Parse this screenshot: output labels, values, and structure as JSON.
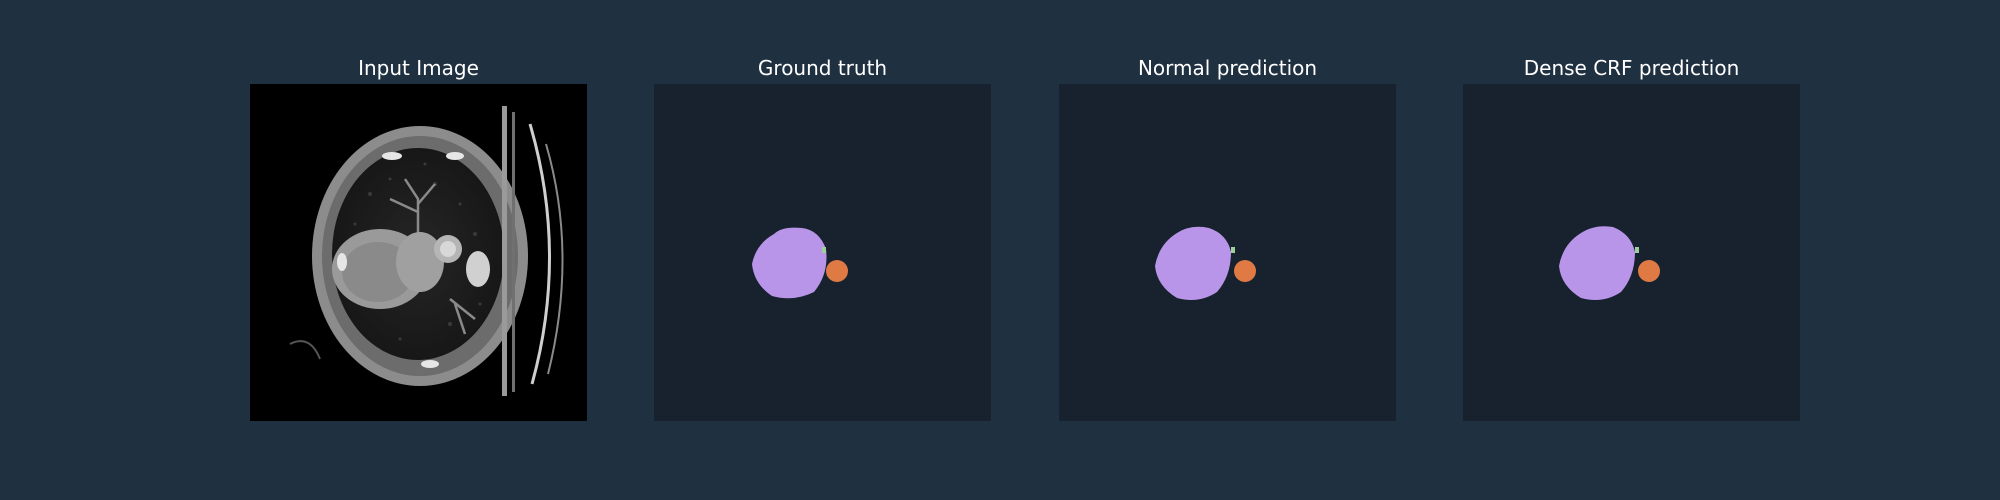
{
  "figure": {
    "panels": [
      {
        "title": "Input Image"
      },
      {
        "title": "Ground truth"
      },
      {
        "title": "Normal prediction"
      },
      {
        "title": "Dense CRF prediction"
      }
    ],
    "colors": {
      "figure_bg": "#1f3041",
      "mask_bg": "#17222e",
      "class_purple": "#b895e8",
      "class_orange": "#e07a45",
      "class_green": "#9ccf9a"
    }
  }
}
